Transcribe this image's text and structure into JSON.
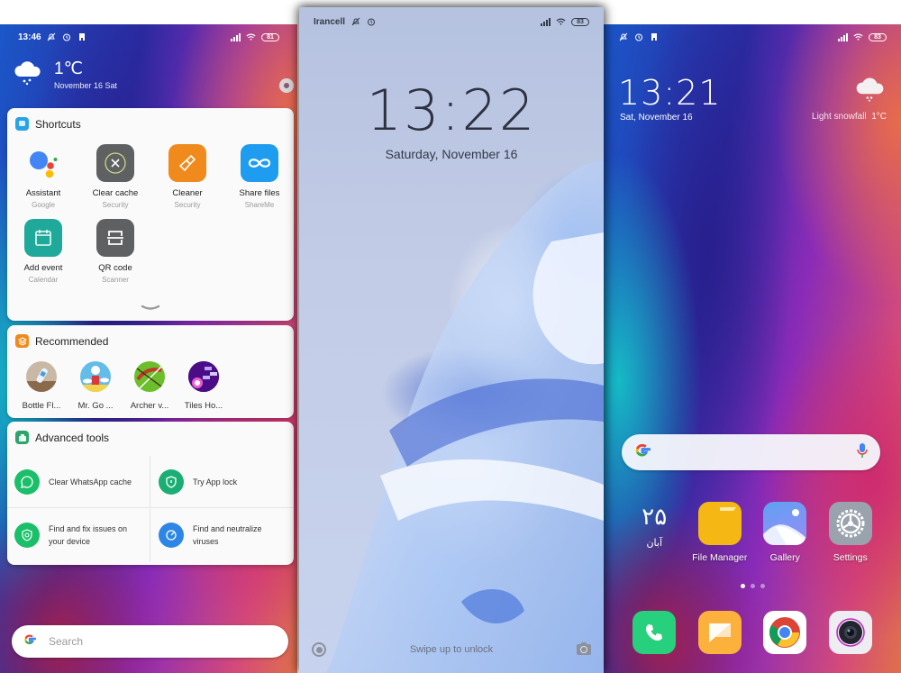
{
  "left_screen": {
    "status_bar": {
      "time": "13:46",
      "battery": "81"
    },
    "weather": {
      "temperature": "1℃",
      "date": "November 16 Sat",
      "icon": "cloud-snow-icon"
    },
    "shortcuts": {
      "title": "Shortcuts",
      "items": [
        {
          "label": "Assistant",
          "sub": "Google",
          "icon": "google-assistant-icon",
          "color": "#ffffff"
        },
        {
          "label": "Clear cache",
          "sub": "Security",
          "icon": "clear-cache-icon",
          "color": "#5f6062"
        },
        {
          "label": "Cleaner",
          "sub": "Security",
          "icon": "broom-icon",
          "color": "#f08a1c"
        },
        {
          "label": "Share files",
          "sub": "ShareMe",
          "icon": "infinity-share-icon",
          "color": "#1e9cf0"
        },
        {
          "label": "Add event",
          "sub": "Calendar",
          "icon": "calendar-icon",
          "color": "#1fa99a"
        },
        {
          "label": "QR code",
          "sub": "Scanner",
          "icon": "qr-scanner-icon",
          "color": "#5f6062"
        }
      ]
    },
    "recommended": {
      "title": "Recommended",
      "items": [
        {
          "label": "Bottle Fl..."
        },
        {
          "label": "Mr. Go ..."
        },
        {
          "label": "Archer v..."
        },
        {
          "label": "Tiles Ho..."
        }
      ]
    },
    "advanced_tools": {
      "title": "Advanced tools",
      "items": [
        {
          "label": "Clear WhatsApp cache",
          "icon": "whatsapp-icon",
          "color": "#1bbf6a"
        },
        {
          "label": "Try App lock",
          "icon": "shield-lock-icon",
          "color": "#1bae74"
        },
        {
          "label": "Find and fix issues on your device",
          "icon": "shield-search-icon",
          "color": "#1bbf6a"
        },
        {
          "label": "Find and neutralize viruses",
          "icon": "virus-scan-icon",
          "color": "#2d86e6"
        }
      ]
    },
    "search": {
      "placeholder": "Search"
    }
  },
  "middle_screen": {
    "status_bar": {
      "carrier": "Irancell",
      "battery": "83"
    },
    "clock": "13:22",
    "date": "Saturday, November 16",
    "unlock_hint": "Swipe up to unlock"
  },
  "right_screen": {
    "status_bar": {
      "battery": "83"
    },
    "clock": "13:21",
    "date": "Sat, November 16",
    "weather": {
      "description": "Light snowfall",
      "temperature": "1°C"
    },
    "persian_date": {
      "day": "۲۵",
      "month": "آبان"
    },
    "apps": [
      {
        "label": "File Manager",
        "icon": "folder-icon"
      },
      {
        "label": "Gallery",
        "icon": "gallery-icon"
      },
      {
        "label": "Settings",
        "icon": "settings-gear-icon"
      }
    ],
    "page_indicator": {
      "pages": 3,
      "current": 1
    },
    "dock": [
      {
        "name": "phone",
        "icon": "phone-icon"
      },
      {
        "name": "messages",
        "icon": "messages-icon"
      },
      {
        "name": "chrome",
        "icon": "chrome-icon"
      },
      {
        "name": "camera",
        "icon": "camera-icon"
      }
    ]
  },
  "colors": {
    "card_bg": "#fafafa",
    "lock_text": "#2d3140",
    "accent_green": "#1bbf6a",
    "accent_blue": "#2d86e6"
  }
}
